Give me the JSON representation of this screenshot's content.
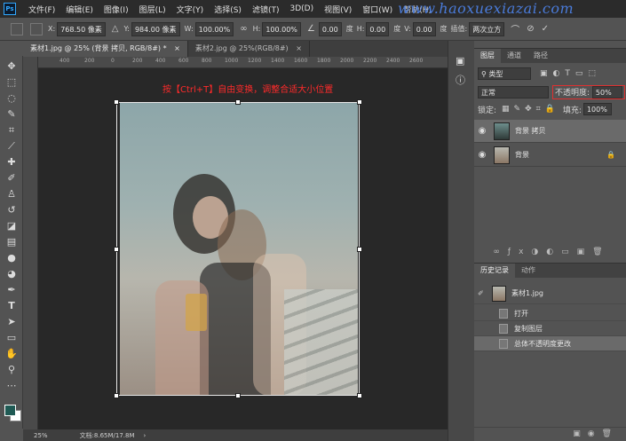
{
  "menubar": {
    "logo": "Ps",
    "items": [
      "文件(F)",
      "编辑(E)",
      "图像(I)",
      "图层(L)",
      "文字(Y)",
      "选择(S)",
      "滤镜(T)",
      "3D(D)",
      "视图(V)",
      "窗口(W)",
      "帮助(H)"
    ],
    "watermark": "www.haoxuexiazai.com"
  },
  "options": {
    "x_label": "X:",
    "x_value": "768.50 像素",
    "y_label": "Y:",
    "y_value": "984.00 像素",
    "w_label": "W:",
    "w_value": "100.00%",
    "h_label": "H:",
    "h_value": "100.00%",
    "angle_value": "0.00",
    "angle_unit": "度",
    "hskew_label": "H:",
    "hskew_value": "0.00",
    "hskew_unit": "度",
    "vskew_label": "V:",
    "vskew_value": "0.00",
    "vskew_unit": "度",
    "interp_label": "插值:",
    "interp_value": "两次立方"
  },
  "tabs": [
    {
      "label": "素材1.jpg @ 25% (背景 拷贝, RGB/8#) *",
      "close": "×"
    },
    {
      "label": "素材2.jpg @ 25%(RGB/8#)",
      "close": "×"
    }
  ],
  "ruler": {
    "ticks": [
      "400",
      "200",
      "0",
      "200",
      "400",
      "600",
      "800",
      "1000",
      "1200",
      "1400",
      "1600",
      "1800",
      "2000",
      "2200",
      "2400",
      "2600"
    ]
  },
  "canvas": {
    "instruction": "按【Ctrl+T】自由变换，调整合适大小位置"
  },
  "status": {
    "zoom": "25%",
    "doc_info": "文档:8.65M/17.8M",
    "arrow": "›"
  },
  "layers_panel": {
    "tabs": [
      "图层",
      "通道",
      "路径"
    ],
    "filter_kind": "类型",
    "blend_mode": "正常",
    "opacity_label": "不透明度:",
    "opacity_value": "50%",
    "lock_label": "锁定:",
    "fill_label": "填充:",
    "fill_value": "100%",
    "layers": [
      {
        "name": "背景 拷贝",
        "selected": true
      },
      {
        "name": "背景",
        "selected": false,
        "locked": true
      }
    ]
  },
  "history_panel": {
    "tabs": [
      "历史记录",
      "动作"
    ],
    "snapshot": "素材1.jpg",
    "items": [
      "打开",
      "复制图层",
      "总体不透明度更改"
    ]
  },
  "colors": {
    "accent_red": "#ff2a2a",
    "highlight_border": "#e03030",
    "foreground": "#1f5a54",
    "background": "#ffffff"
  }
}
